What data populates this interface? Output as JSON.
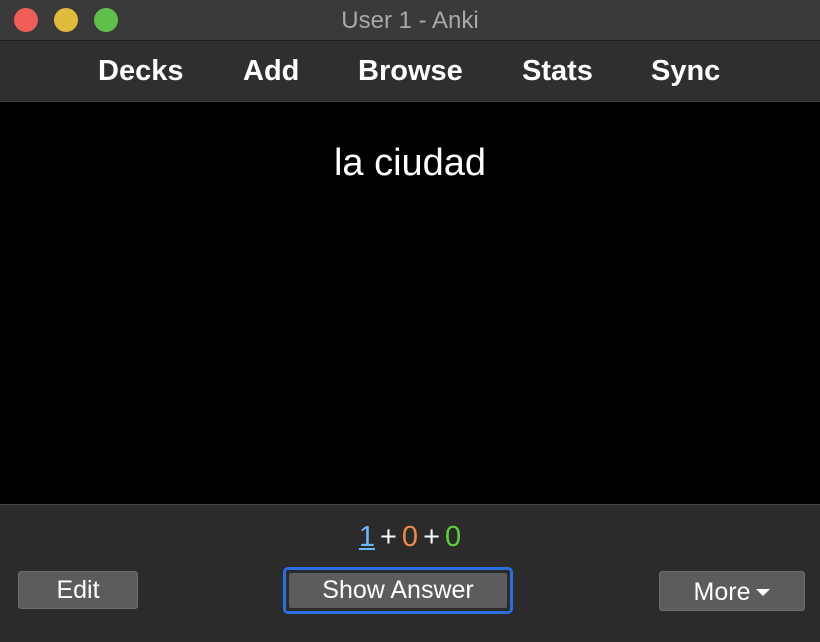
{
  "window": {
    "title": "User 1 - Anki"
  },
  "toolbar": {
    "decks": "Decks",
    "add": "Add",
    "browse": "Browse",
    "stats": "Stats",
    "sync": "Sync"
  },
  "card": {
    "front": "la ciudad"
  },
  "counts": {
    "new": "1",
    "learning": "0",
    "review": "0",
    "separator": "+",
    "colors": {
      "new": "#6cb6ff",
      "learning": "#ee8a4a",
      "review": "#5fd03a"
    }
  },
  "buttons": {
    "edit": "Edit",
    "show_answer": "Show Answer",
    "more": "More",
    "more_icon": "caret-down-icon"
  }
}
